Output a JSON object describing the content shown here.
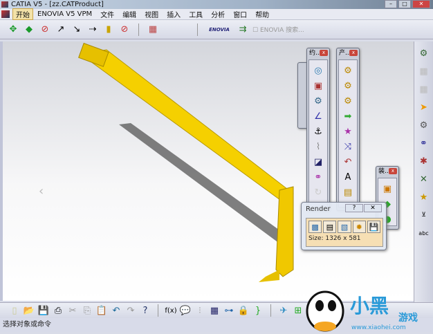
{
  "title": "CATIA V5 - [zz.CATProduct]",
  "window_buttons": [
    "–",
    "□",
    "✕"
  ],
  "menu": [
    "开始",
    "ENOVIA V5 VPM",
    "文件",
    "编辑",
    "视图",
    "插入",
    "工具",
    "分析",
    "窗口",
    "帮助"
  ],
  "toolbar": {
    "enovia_logo": "ENOVIA",
    "enovia_search": "ENOVIA 搜索..."
  },
  "floating_toolbars": [
    {
      "title": "约...",
      "close": "x"
    },
    {
      "title": "产...",
      "close": "x"
    },
    {
      "title": "装...",
      "close": "x"
    }
  ],
  "render": {
    "title": "Render",
    "help": "?",
    "close": "✕",
    "size": "Size: 1326 x 581"
  },
  "status": "选择对象或命令",
  "watermark": {
    "text": "小黑游戏",
    "url": "www.xiaohei.com"
  },
  "colors": {
    "part": "#f5d000",
    "titlebar": "#9fb1c6",
    "menu_active": "#f3e2a8"
  }
}
